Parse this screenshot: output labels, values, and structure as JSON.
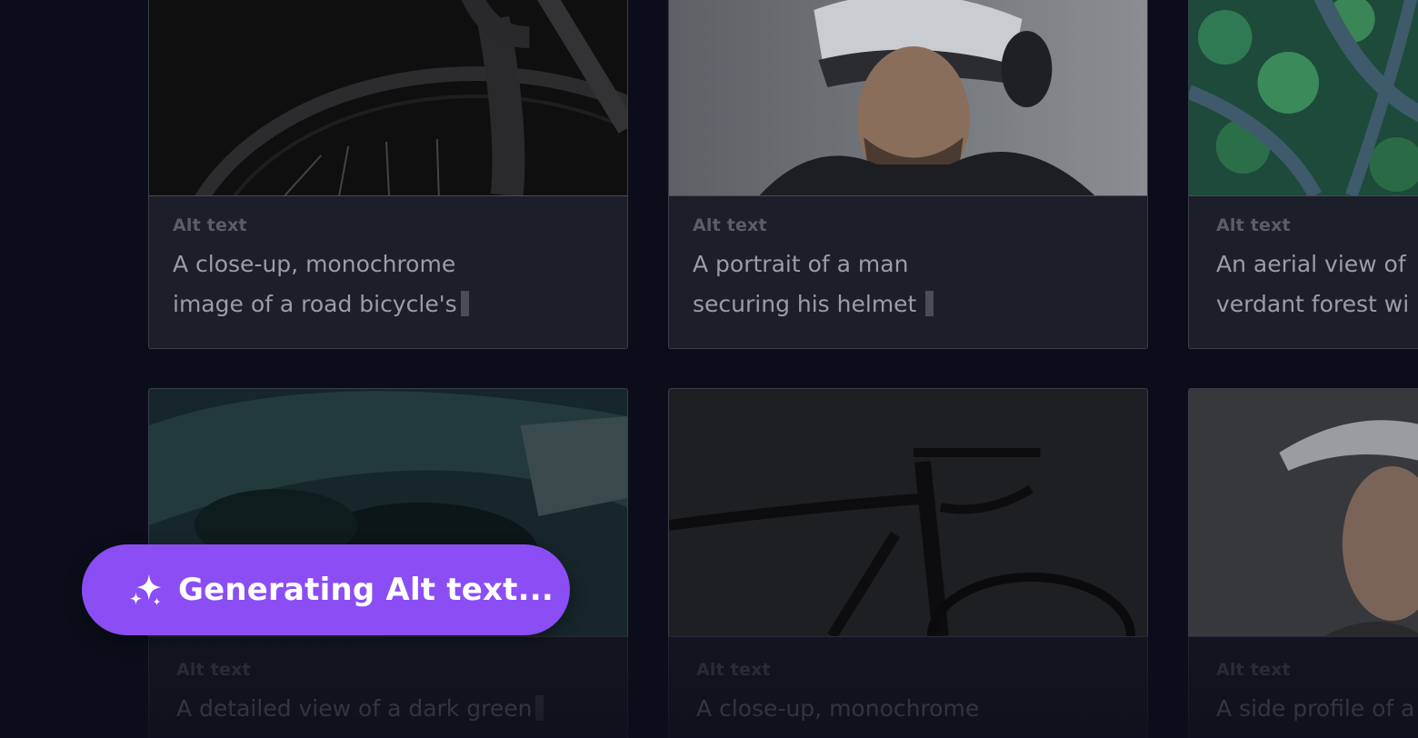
{
  "cards": [
    {
      "label": "Alt text",
      "line1": "A close-up, monochrome",
      "line2": "image of a road bicycle's",
      "image": "bicycle-wheel-monochrome"
    },
    {
      "label": "Alt text",
      "line1": "A portrait of a man",
      "line2": "securing his helmet",
      "image": "man-securing-helmet"
    },
    {
      "label": "Alt text",
      "line1": "An aerial view of",
      "line2": "verdant forest wi",
      "image": "aerial-forest-road"
    },
    {
      "label": "Alt text",
      "line1": "A detailed view of a dark green",
      "image": "dark-green-helmet"
    },
    {
      "label": "Alt text",
      "line1": "A close-up, monochrome",
      "image": "bicycle-frame-dark"
    },
    {
      "label": "Alt text",
      "line1": "A side profile of a",
      "image": "woman-helmet-profile"
    }
  ],
  "generating": {
    "text": "Generating Alt text...",
    "icon": "sparkles-icon",
    "color": "#8b4df4"
  },
  "colors": {
    "background": "#0b0e1a",
    "card": "#1c1e29",
    "border": "#3a3d4a"
  }
}
